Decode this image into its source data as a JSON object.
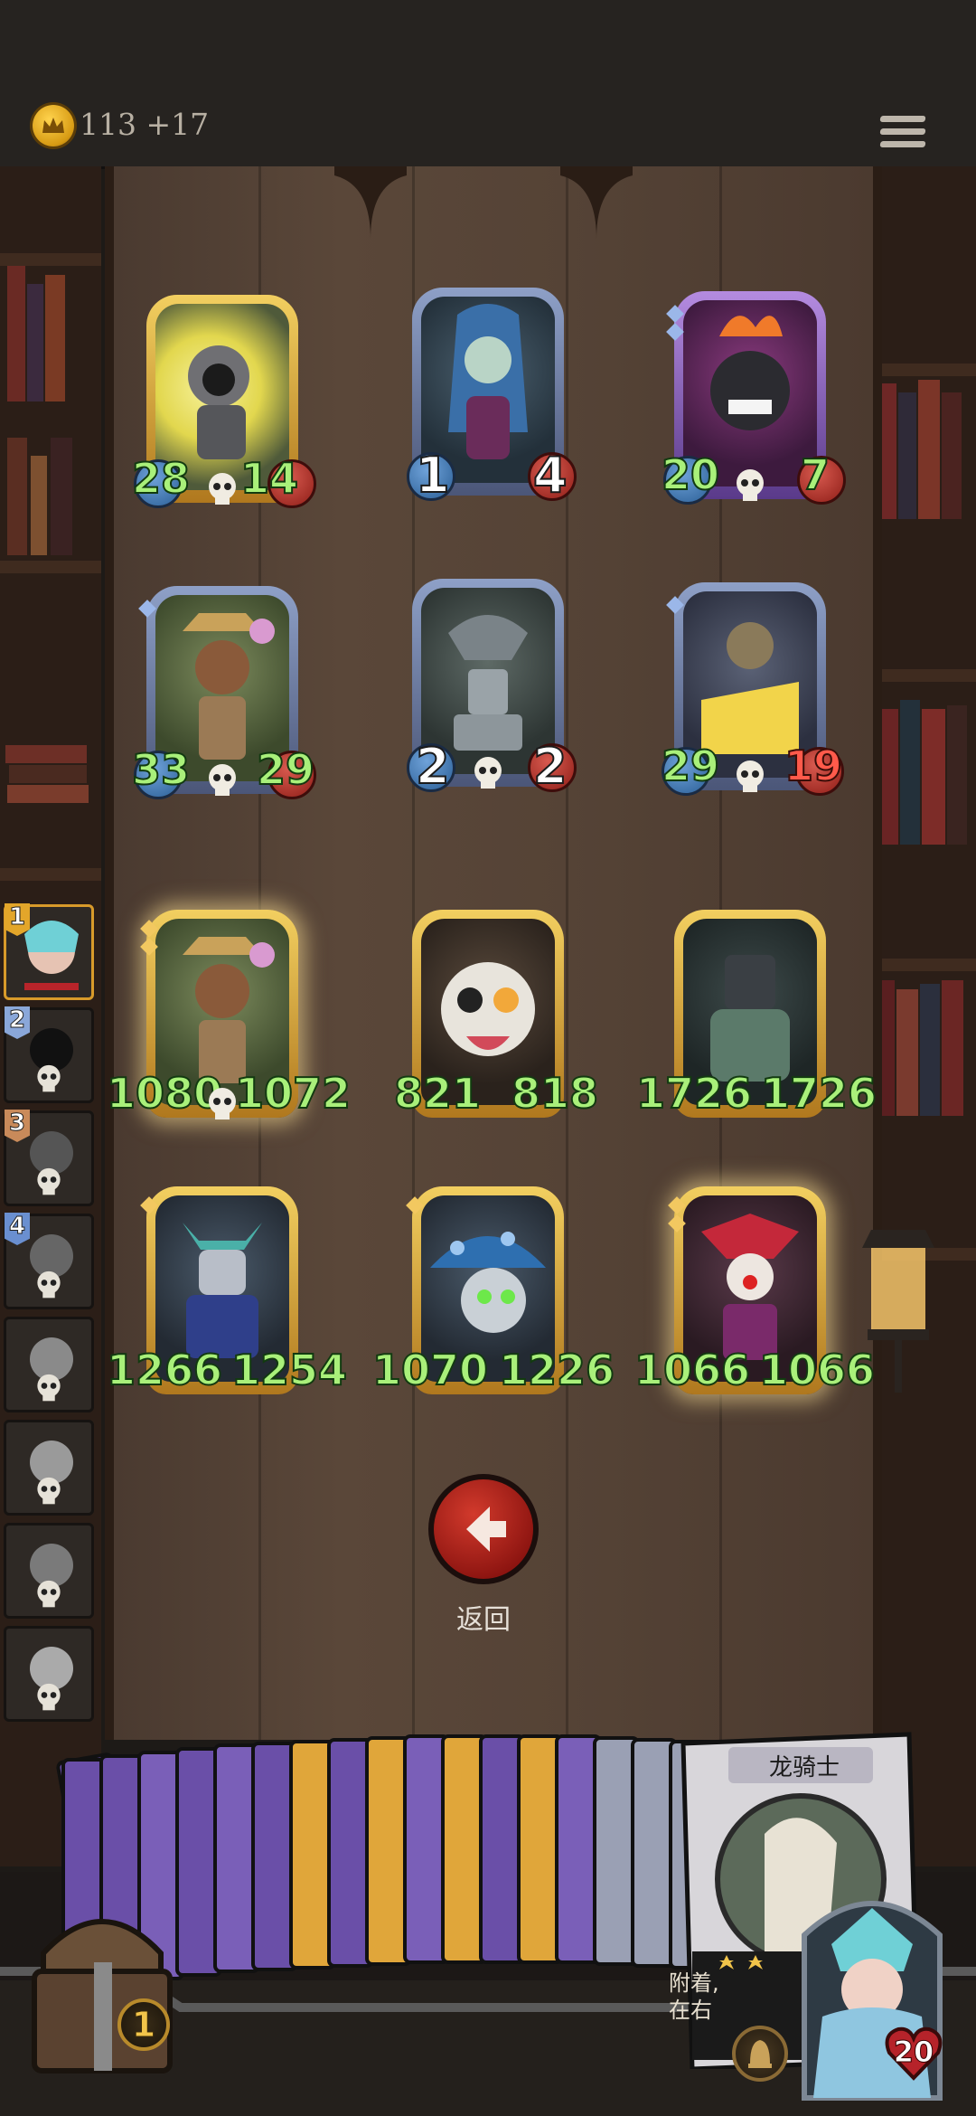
{
  "header": {
    "gold": "113",
    "gold_income": "+17"
  },
  "board": {
    "rows": [
      [
        {
          "atk": "28",
          "hp": "14",
          "frame": "gold"
        },
        {
          "atk": "1",
          "hp": "4",
          "frame": "silver"
        },
        {
          "atk": "20",
          "hp": "7",
          "frame": "purple"
        }
      ],
      [
        {
          "atk": "33",
          "hp": "29",
          "frame": "silver"
        },
        {
          "atk": "2",
          "hp": "2",
          "frame": "silver"
        },
        {
          "atk": "29",
          "hp": "19",
          "frame": "silver"
        }
      ],
      [
        {
          "atk": "1080",
          "hp": "1072",
          "frame": "gold"
        },
        {
          "atk": "821",
          "hp": "818",
          "frame": "gold"
        },
        {
          "atk": "1726",
          "hp": "1726",
          "frame": "gold"
        }
      ],
      [
        {
          "atk": "1266",
          "hp": "1254",
          "frame": "gold"
        },
        {
          "atk": "1070",
          "hp": "1226",
          "frame": "gold"
        },
        {
          "atk": "1066",
          "hp": "1066",
          "frame": "gold"
        }
      ]
    ]
  },
  "sidebar": {
    "ranks": [
      "1",
      "2",
      "3",
      "4"
    ]
  },
  "back_button": {
    "label": "返回"
  },
  "hand": {
    "featured_card": {
      "name": "龙骑士",
      "text_line1": "附着,",
      "text_line2": "在右"
    }
  },
  "chest": {
    "count": "1"
  },
  "hero": {
    "hp": "20"
  },
  "colors": {
    "stat_green": "#a9f07a",
    "back_red": "#c42a1f",
    "gold_frame": "#e0b24a"
  }
}
